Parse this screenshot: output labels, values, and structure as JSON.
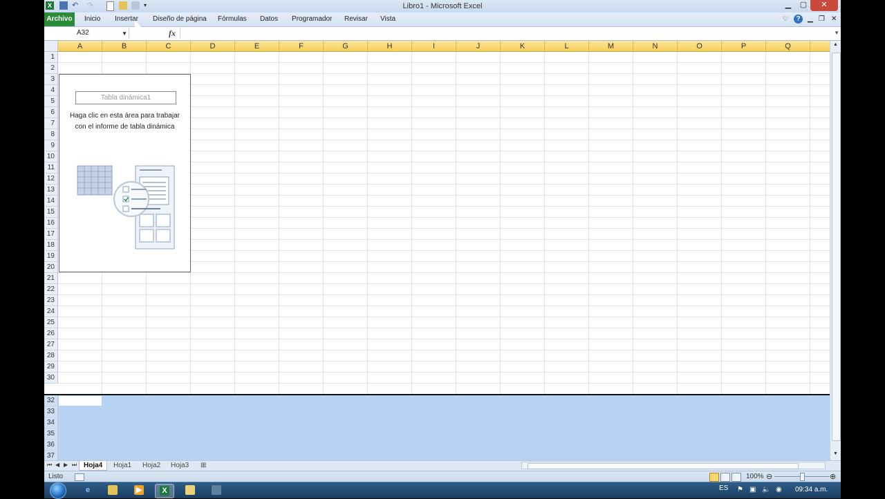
{
  "window": {
    "title": "Libro1  -  Microsoft Excel"
  },
  "ribbon": {
    "tabs": [
      "Archivo",
      "Inicio",
      "Insertar",
      "Diseño de página",
      "Fórmulas",
      "Datos",
      "Programador",
      "Revisar",
      "Vista"
    ]
  },
  "formula_bar": {
    "name_box": "A32",
    "fx_label": "fx",
    "value": ""
  },
  "grid": {
    "columns": [
      "A",
      "B",
      "C",
      "D",
      "E",
      "F",
      "G",
      "H",
      "I",
      "J",
      "K",
      "L",
      "M",
      "N",
      "O",
      "P",
      "Q"
    ],
    "rows_top": [
      "1",
      "2",
      "3",
      "4",
      "5",
      "6",
      "7",
      "8",
      "9",
      "10",
      "11",
      "12",
      "13",
      "14",
      "15",
      "16",
      "17",
      "18",
      "19",
      "20",
      "21",
      "22",
      "23",
      "24",
      "25",
      "26",
      "27",
      "28",
      "29",
      "30"
    ],
    "rows_bottom": [
      "32",
      "33",
      "34",
      "35",
      "36",
      "37"
    ]
  },
  "pivot": {
    "name": "Tabla dinámica1",
    "hint_line1": "Haga clic en esta área para trabajar",
    "hint_line2": "con el informe de tabla dinámica"
  },
  "sheets": {
    "tabs": [
      "Hoja4",
      "Hoja1",
      "Hoja2",
      "Hoja3"
    ],
    "active": "Hoja4"
  },
  "status": {
    "mode": "Listo",
    "zoom": "100%"
  },
  "taskbar": {
    "language": "ES",
    "time": "09:34 a.m."
  },
  "colors": {
    "file_tab": "#2a8b3a",
    "column_header": "#f6cf5a",
    "selection": "#b8d3f1"
  }
}
